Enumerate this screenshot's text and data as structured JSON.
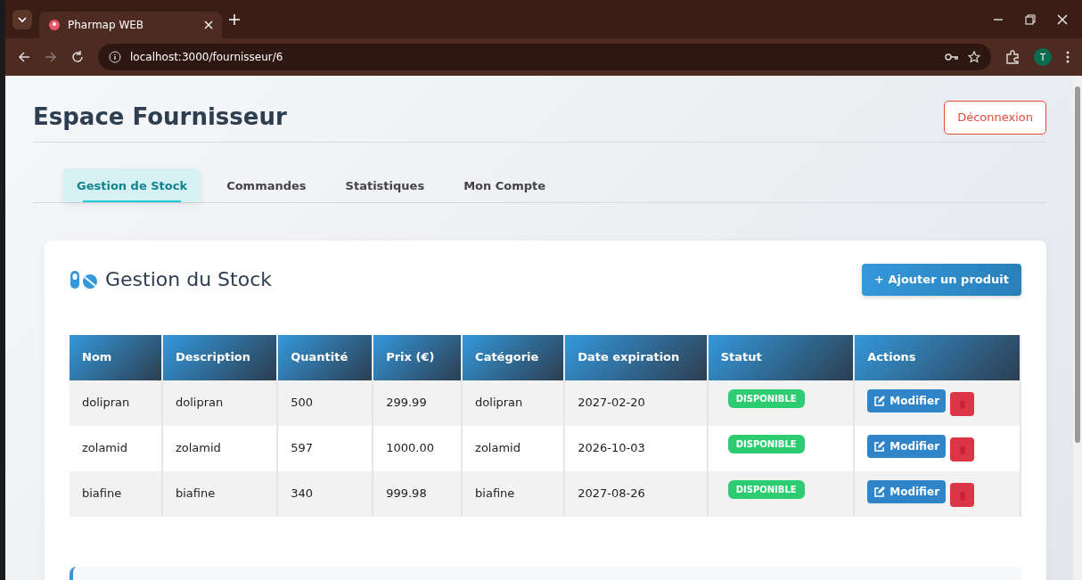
{
  "browser": {
    "tab_title": "Pharmap WEB",
    "url": "localhost:3000/fournisseur/6",
    "profile_initial": "T"
  },
  "header": {
    "title": "Espace Fournisseur",
    "logout": "Déconnexion"
  },
  "tabs": [
    {
      "label": "Gestion de Stock",
      "selected": true
    },
    {
      "label": "Commandes",
      "selected": false
    },
    {
      "label": "Statistiques",
      "selected": false
    },
    {
      "label": "Mon Compte",
      "selected": false
    }
  ],
  "stock": {
    "title": "Gestion du Stock",
    "add_button": "+ Ajouter un produit",
    "table": {
      "columns": [
        "Nom",
        "Description",
        "Quantité",
        "Prix (€)",
        "Catégorie",
        "Date expiration",
        "Statut",
        "Actions"
      ],
      "rows": [
        {
          "cells": [
            "dolipran",
            "dolipran",
            "500",
            "299.99",
            "dolipran",
            "2027-02-20"
          ],
          "status": "DISPONIBLE",
          "edit": "Modifier"
        },
        {
          "cells": [
            "zolamid",
            "zolamid",
            "597",
            "1000.00",
            "zolamid",
            "2026-10-03"
          ],
          "status": "DISPONIBLE",
          "edit": "Modifier"
        },
        {
          "cells": [
            "biafine",
            "biafine",
            "340",
            "999.98",
            "biafine",
            "2027-08-26"
          ],
          "status": "DISPONIBLE",
          "edit": "Modifier"
        }
      ]
    }
  }
}
